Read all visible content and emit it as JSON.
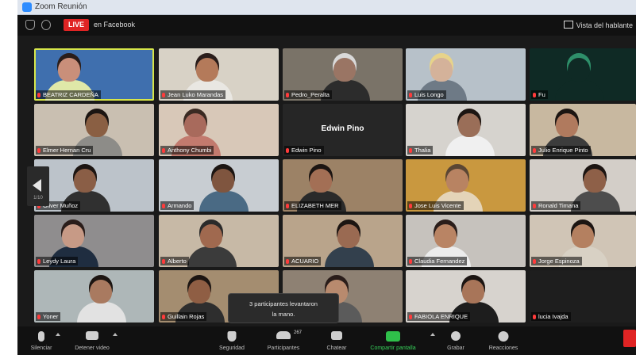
{
  "window": {
    "title": "Zoom Reunión"
  },
  "topbar": {
    "live_badge": "LIVE",
    "live_target": "en Facebook",
    "view_label": "Vista del hablante"
  },
  "participants": [
    {
      "name": "BEATRIZ CARDEÑA",
      "bg": "#3f6fae",
      "skin": "#c98f7a",
      "shirt": "#dfe8a8",
      "hair": "#2a1d1a",
      "active": true
    },
    {
      "name": "Jean Luko Marandas",
      "bg": "#d8d2c6",
      "skin": "#b47a5a",
      "shirt": "#e9e7e2",
      "hair": "#2a1d1a"
    },
    {
      "name": "Pedro_Peralta",
      "bg": "#7a7368",
      "skin": "#9a7564",
      "shirt": "#2c2c2c",
      "hair": "#d9d9d9"
    },
    {
      "name": "Luis Longo",
      "bg": "#b7c1c9",
      "skin": "#d4b29a",
      "shirt": "#6e7a86",
      "hair": "#e7d38a"
    },
    {
      "name": "Fu",
      "bg": "#0f2a25",
      "skin": "#0f2a25",
      "shirt": "#0f2a25",
      "hair": "#2e8f6a"
    },
    {
      "name": "Elmer Hernan Cru",
      "bg": "#c9bfb1",
      "skin": "#8a5f43",
      "shirt": "#8d8c88",
      "hair": "#1c1512"
    },
    {
      "name": "Anthony Chumbi",
      "bg": "#d8c8b8",
      "skin": "#a86a5c",
      "shirt": "#c27a6e",
      "hair": "#3a2a22"
    },
    {
      "name": "Edwin Pino",
      "bg": "#262626",
      "camera_off": true
    },
    {
      "name": "Thalia",
      "bg": "#d6d3ce",
      "skin": "#9a6e58",
      "shirt": "#f0f0f0",
      "hair": "#1c1512"
    },
    {
      "name": "Julio Enrique Pinto",
      "bg": "#c8b8a0",
      "skin": "#b07a5e",
      "shirt": "#3c3c3c",
      "hair": "#1c1512"
    },
    {
      "name": "Oliver Muñoz",
      "bg": "#bcc3ca",
      "skin": "#8a5e46",
      "shirt": "#303030",
      "hair": "#1c1512"
    },
    {
      "name": "Armando",
      "bg": "#c8cdd2",
      "skin": "#7f553f",
      "shirt": "#4a6a84",
      "hair": "#1c1512"
    },
    {
      "name": "ELIZABETH MER",
      "bg": "#9c8266",
      "skin": "#a36f55",
      "shirt": "#2a2a2a",
      "hair": "#1c1512"
    },
    {
      "name": "Jose Luis Vicente",
      "bg": "#c9983f",
      "skin": "#b88362",
      "shirt": "#e4d4b8",
      "hair": "#5a4634"
    },
    {
      "name": "Ronald Timana",
      "bg": "#d3cec8",
      "skin": "#8e6048",
      "shirt": "#4d4d4d",
      "hair": "#1c1512"
    },
    {
      "name": "Leydy Laura",
      "bg": "#8f8d8e",
      "skin": "#c79a86",
      "shirt": "#1f2d40",
      "hair": "#2a1d1a"
    },
    {
      "name": "Alberto",
      "bg": "#c7b9a6",
      "skin": "#a0694f",
      "shirt": "#3b3b3b",
      "hair": "#2a2a2a"
    },
    {
      "name": "ACUARIO",
      "bg": "#b9a48b",
      "skin": "#9a6a52",
      "shirt": "#33404d",
      "hair": "#1c1512"
    },
    {
      "name": "Claudia Fernandez",
      "bg": "#c6c2bd",
      "skin": "#b98464",
      "shirt": "#ececec",
      "hair": "#2a1d1a"
    },
    {
      "name": "Jorge Espinoza",
      "bg": "#d0c5b6",
      "skin": "#b48060",
      "shirt": "#d8d1c4",
      "hair": "#1c1512"
    },
    {
      "name": "Yoner",
      "bg": "#aeb7b8",
      "skin": "#a97a60",
      "shirt": "#e2e2e2",
      "hair": "#1c1512"
    },
    {
      "name": "Guillain Rojas",
      "bg": "#a48d70",
      "skin": "#8f5e44",
      "shirt": "#2e2e2e",
      "hair": "#1c1512"
    },
    {
      "name": "",
      "bg": "#8e8173",
      "skin": "#b88a6e",
      "shirt": "#5b5b5b",
      "hair": "#2a1d1a"
    },
    {
      "name": "FABIOLA ENRIQUE",
      "bg": "#d7d3ce",
      "skin": "#a87559",
      "shirt": "#1d1d1d",
      "hair": "#1c1512"
    },
    {
      "name": "lucia Ivajda",
      "bg": "#1e1e1e",
      "camera_off": true
    }
  ],
  "pager": {
    "page": "1/10"
  },
  "notice": {
    "line1": "3 participantes levantaron",
    "line2": "la mano."
  },
  "toolbar": {
    "mute": "Silenciar",
    "video": "Detener video",
    "security": "Seguridad",
    "participants": "Participantes",
    "participants_count": "267",
    "chat": "Chatear",
    "share": "Compartir pantalla",
    "record": "Grabar",
    "reactions": "Reacciones"
  }
}
